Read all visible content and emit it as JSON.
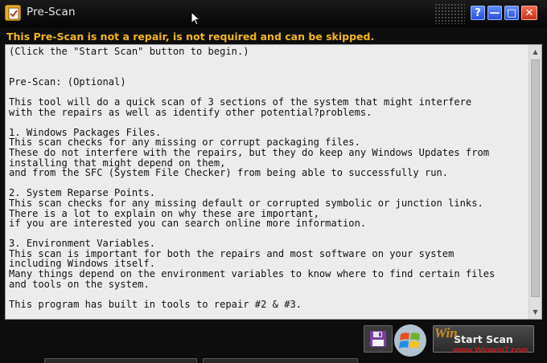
{
  "window": {
    "title": "Pre-Scan",
    "buttons": {
      "help": "?",
      "minimize": "—",
      "maximize": "□",
      "close": "✕"
    }
  },
  "warning": "This Pre-Scan is not a repair, is not required and can be skipped.",
  "body_lines": [
    "(Click the \"Start Scan\" button to begin.)",
    "",
    "",
    "Pre-Scan: (Optional)",
    "",
    "This tool will do a quick scan of 3 sections of the system that might interfere",
    "with the repairs as well as identify other potential?problems.",
    "",
    "1. Windows Packages Files.",
    "This scan checks for any missing or corrupt packaging files.",
    "These do not interfere with the repairs, but they do keep any Windows Updates from",
    "installing that might depend on them,",
    "and from the SFC (System File Checker) from being able to successfully run.",
    "",
    "2. System Reparse Points.",
    "This scan checks for any missing default or corrupted symbolic or junction links.",
    "There is a lot to explain on why these are important,",
    "if you are interested you can search online more information.",
    "",
    "3. Environment Variables.",
    "This scan is important for both the repairs and most software on your system",
    "including Windows itself.",
    "Many things depend on the environment variables to know where to find certain files",
    "and tools on the system.",
    "",
    "This program has built in tools to repair #2 & #3."
  ],
  "actions": {
    "start_scan": "Start Scan"
  },
  "watermark": {
    "brand": "Win",
    "url": "www.Winwin7.com"
  },
  "colors": {
    "warning": "#f3b51f",
    "title_bar": "#0d0d0d",
    "text_background": "#ececec",
    "window_button": "#3b63e8",
    "close_button": "#d9432b"
  },
  "icons": {
    "app": "checklist-icon",
    "save": "floppy-disk-icon",
    "cursor": "mouse-pointer-icon"
  }
}
